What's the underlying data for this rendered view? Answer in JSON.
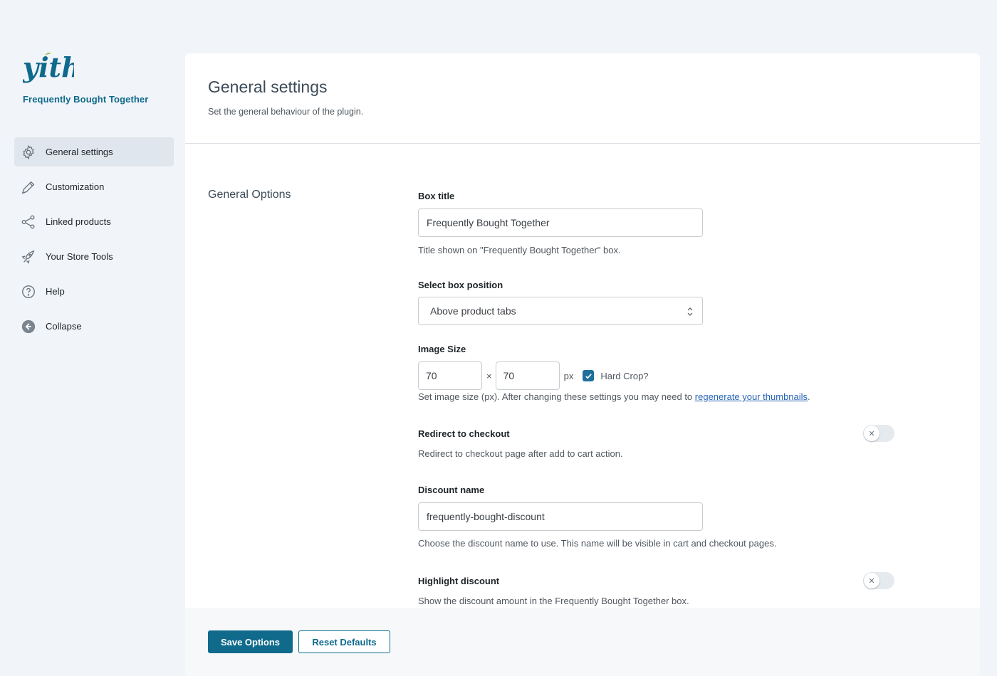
{
  "brand": {
    "logo_text": "yith",
    "plugin_name": "Frequently Bought Together",
    "accent": "#0f6a8c",
    "logo_green": "#8bc34a"
  },
  "sidebar": {
    "items": [
      {
        "label": "General settings",
        "icon": "gear-icon",
        "active": true
      },
      {
        "label": "Customization",
        "icon": "pencil-icon"
      },
      {
        "label": "Linked products",
        "icon": "share-icon"
      },
      {
        "label": "Your Store Tools",
        "icon": "rocket-icon"
      },
      {
        "label": "Help",
        "icon": "question-circle-icon"
      },
      {
        "label": "Collapse",
        "icon": "collapse-arrow-icon"
      }
    ]
  },
  "header": {
    "title": "General settings",
    "description": "Set the general behaviour of the plugin."
  },
  "section": {
    "title": "General Options"
  },
  "fields": {
    "box_title": {
      "label": "Box title",
      "value": "Frequently Bought Together",
      "help": "Title shown on \"Frequently Bought Together\" box."
    },
    "box_position": {
      "label": "Select box position",
      "value": "Above product tabs"
    },
    "image_size": {
      "label": "Image Size",
      "width": "70",
      "height": "70",
      "times": "×",
      "unit": "px",
      "hard_crop_label": "Hard Crop?",
      "hard_crop_checked": true,
      "help_prefix": "Set image size (px). After changing these settings you may need to ",
      "help_link": "regenerate your thumbnails",
      "help_suffix": "."
    },
    "redirect": {
      "label": "Redirect to checkout",
      "help": "Redirect to checkout page after add to cart action.",
      "enabled": false
    },
    "discount_name": {
      "label": "Discount name",
      "value": "frequently-bought-discount",
      "help": "Choose the discount name to use. This name will be visible in cart and checkout pages."
    },
    "highlight": {
      "label": "Highlight discount",
      "help": "Show the discount amount in the Frequently Bought Together box.",
      "enabled": false
    }
  },
  "footer": {
    "save_label": "Save Options",
    "reset_label": "Reset Defaults"
  }
}
